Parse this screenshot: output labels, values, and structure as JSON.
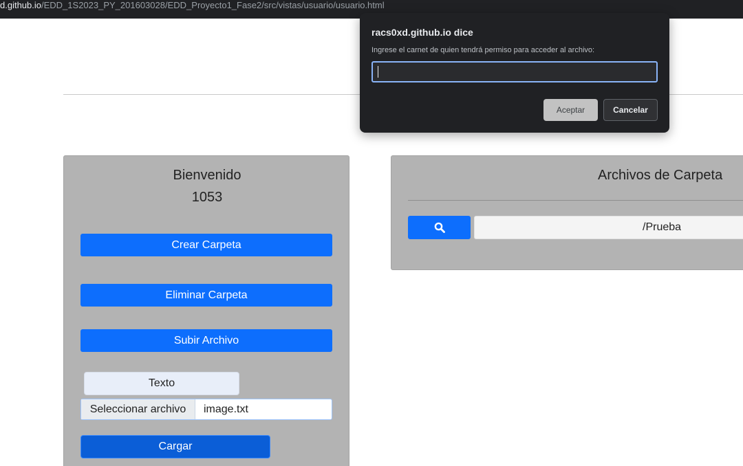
{
  "browser": {
    "url_host": "d.github.io",
    "url_path": "/EDD_1S2023_PY_201603028/EDD_Proyecto1_Fase2/src/vistas/usuario/usuario.html"
  },
  "left_panel": {
    "welcome": "Bienvenido",
    "user_id": "1053",
    "create_folder": "Crear Carpeta",
    "delete_folder": "Eliminar Carpeta",
    "upload_file": "Subir Archivo",
    "file_type": "Texto",
    "file_picker_label": "Seleccionar archivo",
    "file_name": "image.txt",
    "load": "Cargar"
  },
  "right_panel": {
    "title": "Archivos de Carpeta",
    "search_icon": "search-icon",
    "path": "/Prueba"
  },
  "dialog": {
    "title": "racs0xd.github.io dice",
    "message": "Ingrese el carnet de quien tendrá permiso para acceder al archivo:",
    "input_value": "",
    "accept": "Aceptar",
    "cancel": "Cancelar"
  },
  "colors": {
    "primary": "#0d6efd",
    "panel_bg": "#b3b3b3",
    "dialog_bg": "#202124",
    "dialog_focus": "#8ab4f8"
  }
}
